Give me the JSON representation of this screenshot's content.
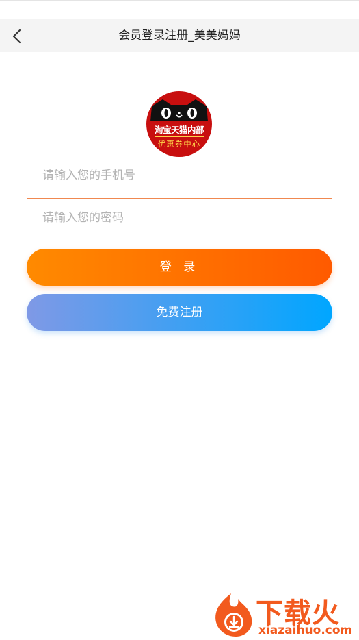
{
  "navbar": {
    "back_icon": "chevron-left-icon",
    "title": "会员登录注册_美美妈妈"
  },
  "logo": {
    "line1": "淘宝天猫内部",
    "line2": "优惠券中心",
    "brand_color": "#c80f0f"
  },
  "form": {
    "phone_placeholder": "请输入您的手机号",
    "phone_value": "",
    "password_placeholder": "请输入您的密码",
    "password_value": "",
    "underline_color": "#f08850"
  },
  "buttons": {
    "login_label": "登 录",
    "register_label": "免费注册",
    "login_colors": [
      "#ff8a00",
      "#ff5a00"
    ],
    "register_colors": [
      "#7f99e6",
      "#00a6ff"
    ]
  },
  "watermark": {
    "cn": "下载火",
    "en": "xiazaihuo.com",
    "color": "#f25a1e"
  }
}
